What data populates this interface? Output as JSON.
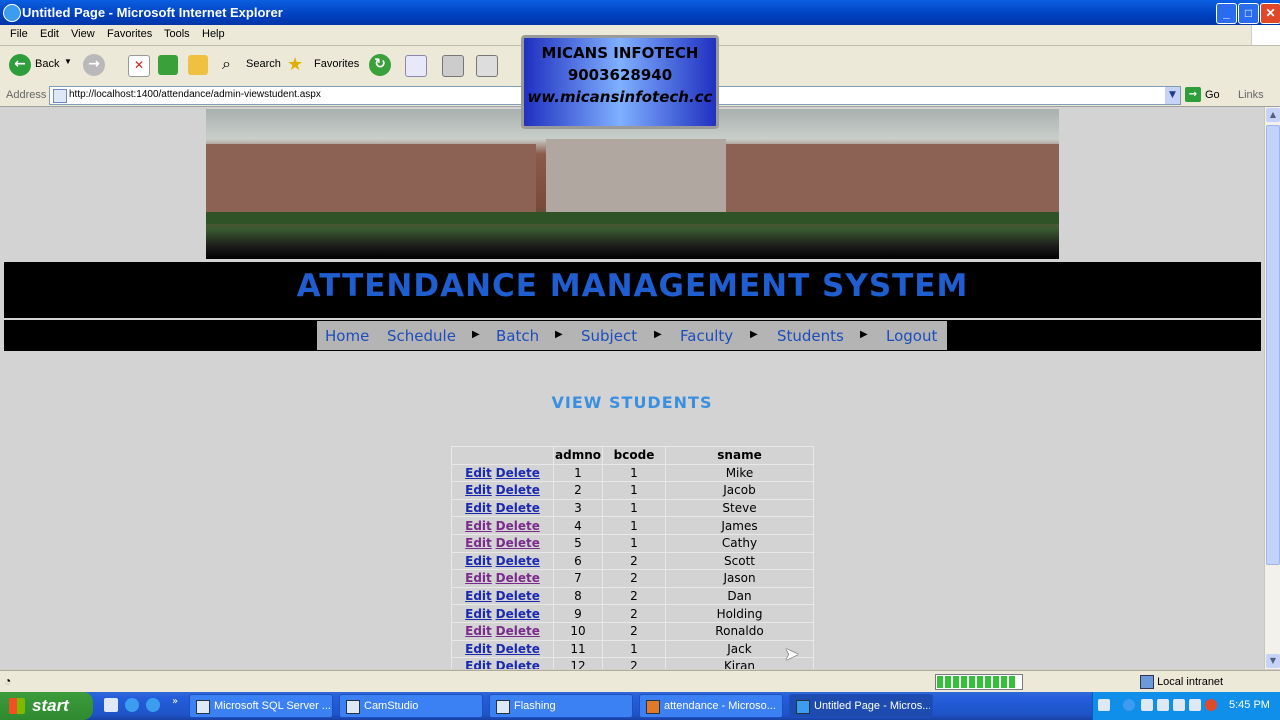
{
  "window": {
    "title": "Untitled Page - Microsoft Internet Explorer"
  },
  "menu": [
    "File",
    "Edit",
    "View",
    "Favorites",
    "Tools",
    "Help"
  ],
  "toolbar": {
    "back": "Back",
    "search": "Search",
    "favorites": "Favorites"
  },
  "address": {
    "label": "Address",
    "url": "http://localhost:1400/attendance/admin-viewstudent.aspx",
    "go": "Go",
    "links": "Links"
  },
  "watermark": {
    "line1": "MICANS INFOTECH",
    "line2": "9003628940",
    "line3": "ww.micansinfotech.cc"
  },
  "page": {
    "app_title": "ATTENDANCE MANAGEMENT SYSTEM",
    "nav": [
      "Home",
      "Schedule",
      "Batch",
      "Subject",
      "Faculty",
      "Students",
      "Logout"
    ],
    "heading": "VIEW STUDENTS",
    "grid": {
      "headers": [
        "",
        "admno",
        "bcode",
        "sname"
      ],
      "edit_label": "Edit",
      "delete_label": "Delete",
      "rows": [
        [
          "1",
          "1",
          "Mike"
        ],
        [
          "2",
          "1",
          "Jacob"
        ],
        [
          "3",
          "1",
          "Steve"
        ],
        [
          "4",
          "1",
          "James"
        ],
        [
          "5",
          "1",
          "Cathy"
        ],
        [
          "6",
          "2",
          "Scott"
        ],
        [
          "7",
          "2",
          "Jason"
        ],
        [
          "8",
          "2",
          "Dan"
        ],
        [
          "9",
          "2",
          "Holding"
        ],
        [
          "10",
          "2",
          "Ronaldo"
        ],
        [
          "11",
          "1",
          "Jack"
        ],
        [
          "12",
          "2",
          "Kiran"
        ]
      ]
    }
  },
  "status": {
    "zone": "Local intranet",
    "progress": 0.95
  },
  "taskbar": {
    "start": "start",
    "tasks": [
      "Microsoft SQL Server ...",
      "CamStudio",
      "Flashing",
      "attendance - Microso...",
      "Untitled Page - Micros..."
    ],
    "clock": "5:45 PM"
  }
}
